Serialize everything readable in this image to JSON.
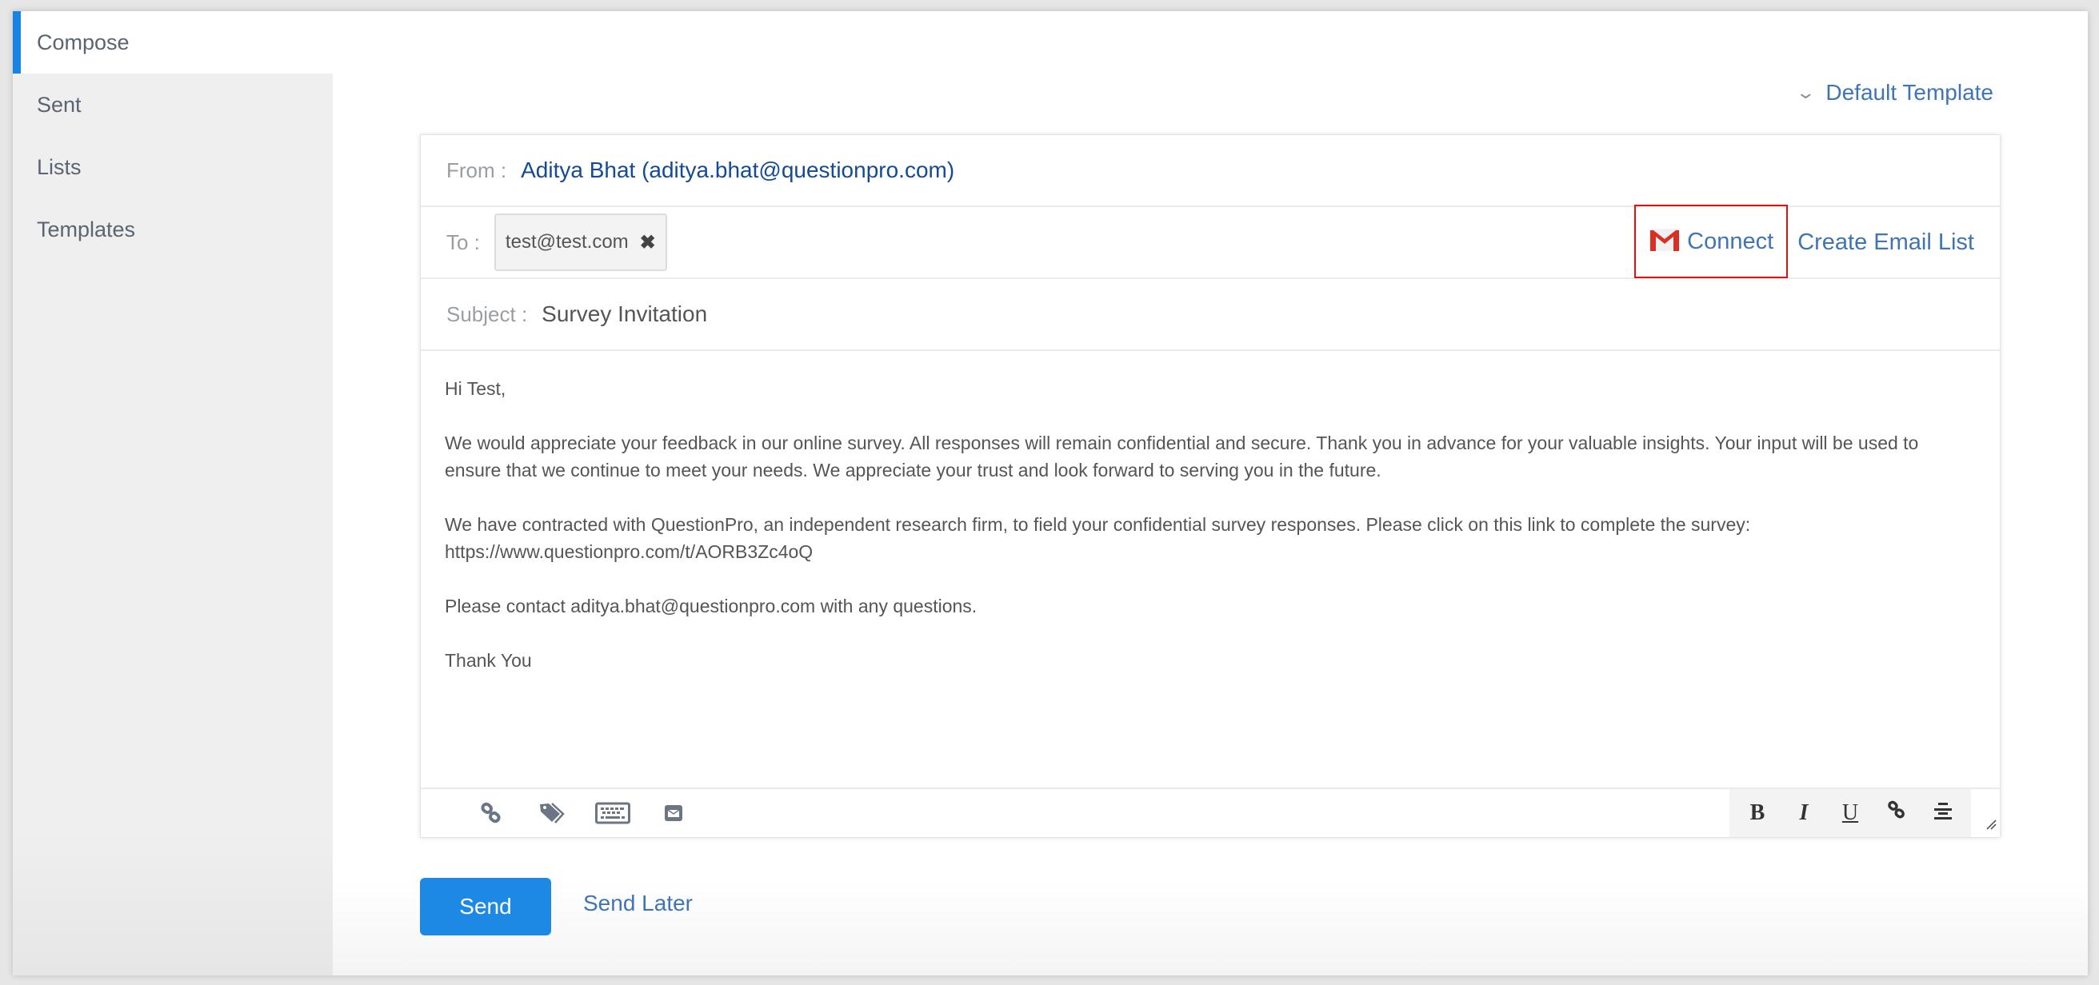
{
  "sidebar": {
    "items": [
      {
        "label": "Compose",
        "active": true
      },
      {
        "label": "Sent"
      },
      {
        "label": "Lists"
      },
      {
        "label": "Templates"
      }
    ]
  },
  "template_select": {
    "label": "Default Template",
    "icon": "chevron-down-icon"
  },
  "compose": {
    "from_label": "From :",
    "from_value": "Aditya Bhat (aditya.bhat@questionpro.com)",
    "to_label": "To :",
    "recipients": [
      "test@test.com"
    ],
    "remove_glyph": "✖",
    "connect_label": "Connect",
    "create_list_label": "Create Email List",
    "subject_label": "Subject :",
    "subject_value": "Survey Invitation",
    "body": [
      "Hi Test,",
      "We would appreciate your feedback in our online survey.  All responses will remain confidential and secure. Thank you in advance for your valuable insights. Your input will be used to ensure that we continue to meet your needs. We appreciate your trust and look forward to serving you in the future.",
      "We have contracted with QuestionPro, an independent research firm, to field your confidential survey responses.  Please click on this link to complete the survey:",
      "https://www.questionpro.com/t/AORB3Zc4oQ",
      "Please contact aditya.bhat@questionpro.com with any questions.",
      "Thank You"
    ]
  },
  "toolbar": {
    "left_icons": [
      "link-icon",
      "tags-icon",
      "keyboard-icon",
      "email-icon"
    ],
    "format": {
      "bold": "B",
      "italic": "I",
      "underline": "U"
    }
  },
  "actions": {
    "send_label": "Send",
    "send_later_label": "Send Later"
  },
  "colors": {
    "accent": "#1e88e5",
    "link": "#3f75b5",
    "highlight_box": "#e01010"
  }
}
